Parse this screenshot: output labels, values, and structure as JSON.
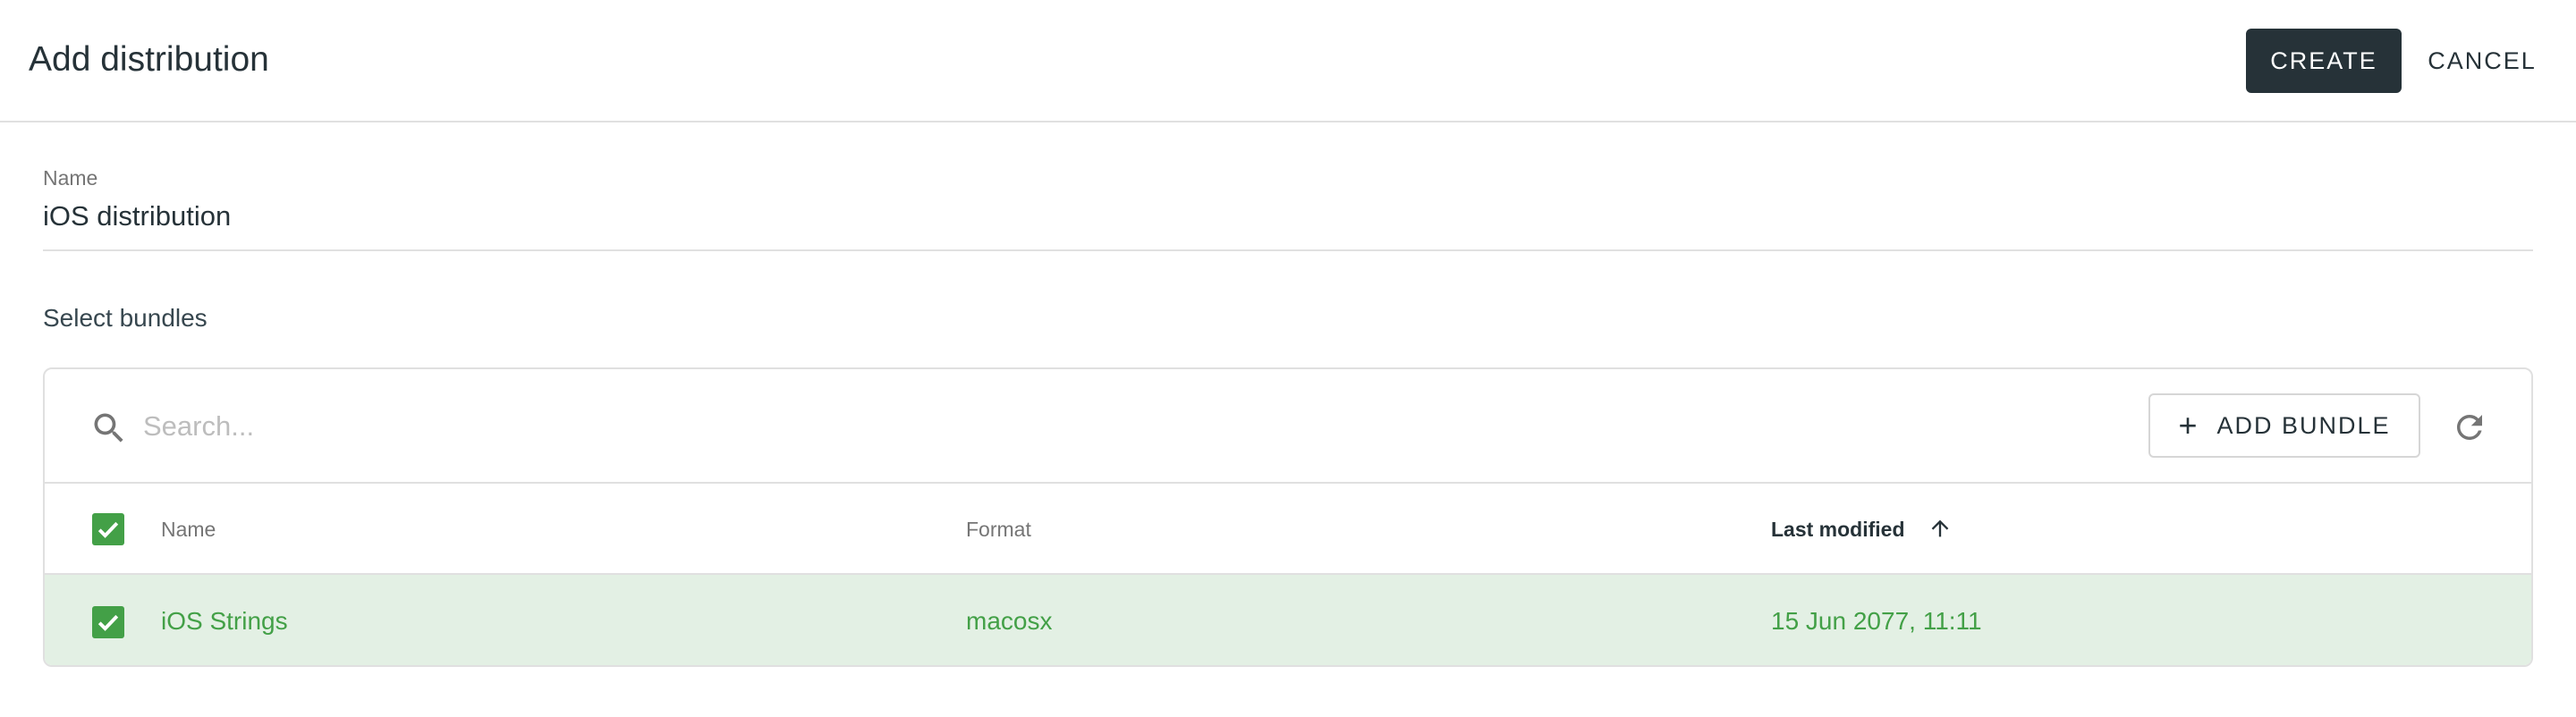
{
  "header": {
    "title": "Add distribution",
    "create_label": "CREATE",
    "cancel_label": "CANCEL"
  },
  "name_field": {
    "label": "Name",
    "value": "iOS distribution"
  },
  "bundles_section": {
    "label": "Select bundles"
  },
  "toolbar": {
    "search_placeholder": "Search...",
    "add_bundle_label": "ADD BUNDLE",
    "add_icon": "plus-icon",
    "refresh_icon": "refresh-icon",
    "search_icon": "search-icon"
  },
  "table": {
    "columns": [
      {
        "label": "Name"
      },
      {
        "label": "Format"
      },
      {
        "label": "Last modified",
        "sort": "ascending"
      }
    ],
    "header_checked": true,
    "rows": [
      {
        "checked": true,
        "name": "iOS Strings",
        "format": "macosx",
        "last_modified": "15 Jun 2077, 11:11"
      }
    ]
  },
  "colors": {
    "primary_dark": "#263238",
    "accent_green": "#43a047",
    "selected_row_bg": "#e3f0e4",
    "divider": "#e0e0e0"
  }
}
